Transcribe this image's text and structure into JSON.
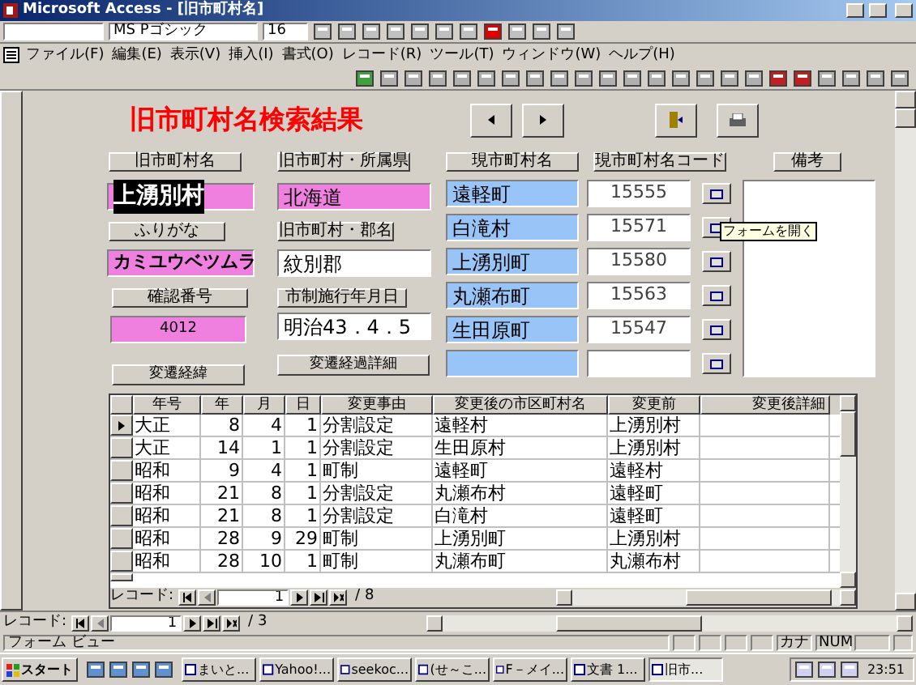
{
  "window": {
    "title": "Microsoft Access - [旧市町村名]"
  },
  "format_toolbar": {
    "font_name": "MS Pゴシック",
    "font_size": "16"
  },
  "menu": [
    "ファイル(F)",
    "編集(E)",
    "表示(V)",
    "挿入(I)",
    "書式(O)",
    "レコード(R)",
    "ツール(T)",
    "ウィンドウ(W)",
    "ヘルプ(H)"
  ],
  "form": {
    "title": "旧市町村名検索結果",
    "old_name": {
      "label": "旧市町村名",
      "value": "上湧別村",
      "highlighted": true
    },
    "furigana": {
      "label": "ふりがな",
      "value": "カミユウベツムラ"
    },
    "confirm_no": {
      "label": "確認番号",
      "value": "4012"
    },
    "history_button": "変遷経緯",
    "prefecture": {
      "label": "旧市町村・所属県",
      "value": "北海道"
    },
    "county": {
      "label": "旧市町村・郡名",
      "value": "紋別郡"
    },
    "city_date": {
      "label": "市制施行年月日",
      "value": "明治43．4．5"
    },
    "detail_button": "変遷経過詳細",
    "current_header": "現市町村名",
    "code_header": "現市町村名コード",
    "notes_label": "備考",
    "current": [
      {
        "name": "遠軽町",
        "code": "15555"
      },
      {
        "name": "白滝村",
        "code": "15571"
      },
      {
        "name": "上湧別町",
        "code": "15580"
      },
      {
        "name": "丸瀬布町",
        "code": "15563"
      },
      {
        "name": "生田原町",
        "code": "15547"
      }
    ],
    "tooltip": "フォームを開く"
  },
  "table": {
    "columns": [
      "年号",
      "年",
      "月",
      "日",
      "変更事由",
      "変更後の市区町村名",
      "変更前",
      "変更後詳細"
    ],
    "rows": [
      {
        "selected": true,
        "cells": [
          "大正",
          "8",
          "4",
          "1",
          "分割設定",
          "遠軽村",
          "上湧別村"
        ]
      },
      {
        "selected": false,
        "cells": [
          "大正",
          "14",
          "1",
          "1",
          "分割設定",
          "生田原村",
          "上湧別村"
        ]
      },
      {
        "selected": false,
        "cells": [
          "昭和",
          "9",
          "4",
          "1",
          "町制",
          "遠軽町",
          "遠軽村"
        ]
      },
      {
        "selected": false,
        "cells": [
          "昭和",
          "21",
          "8",
          "1",
          "分割設定",
          "丸瀬布村",
          "遠軽町"
        ]
      },
      {
        "selected": false,
        "cells": [
          "昭和",
          "21",
          "8",
          "1",
          "分割設定",
          "白滝村",
          "遠軽町"
        ]
      },
      {
        "selected": false,
        "cells": [
          "昭和",
          "28",
          "9",
          "29",
          "町制",
          "上湧別町",
          "上湧別村"
        ]
      },
      {
        "selected": false,
        "cells": [
          "昭和",
          "28",
          "10",
          "1",
          "町制",
          "丸瀬布町",
          "丸瀬布村"
        ]
      }
    ]
  },
  "subform_nav": {
    "label": "レコード:",
    "record": "1",
    "total": "/ 8"
  },
  "form_nav": {
    "label": "レコード:",
    "record": "1",
    "total": "/ 3"
  },
  "status_bar": {
    "text": "フォーム ビュー",
    "indicators": [
      "カナ",
      "NUM"
    ]
  },
  "taskbar": {
    "start": "スタート",
    "tasks": [
      {
        "label": "まいと...",
        "selected": false
      },
      {
        "label": "Yahoo!...",
        "selected": false
      },
      {
        "label": "seekoc...",
        "selected": false
      },
      {
        "label": "(せ～こ...",
        "selected": false
      },
      {
        "label": "F－メイ...",
        "selected": false
      },
      {
        "label": "文書 1...",
        "selected": false
      },
      {
        "label": "旧市...",
        "selected": true
      }
    ],
    "clock": "23:51"
  }
}
